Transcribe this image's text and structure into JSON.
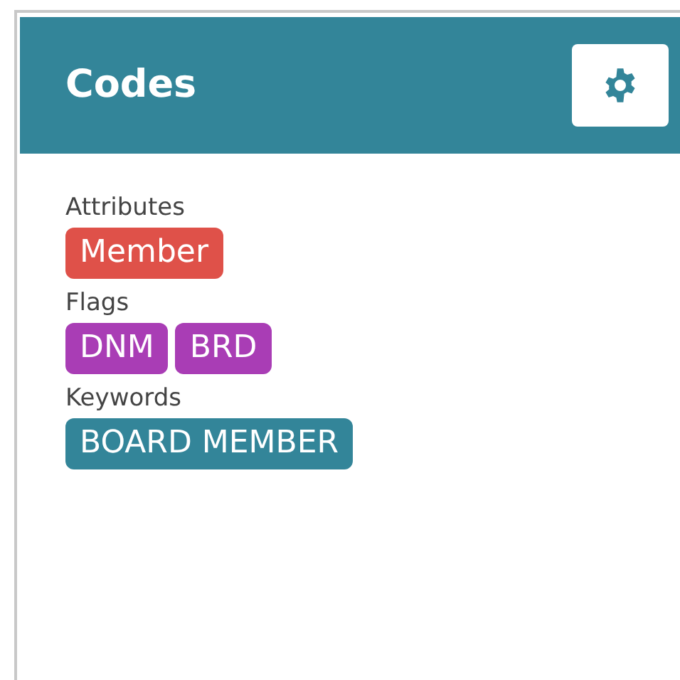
{
  "panel": {
    "title": "Codes"
  },
  "groups": [
    {
      "label": "Attributes",
      "tags": [
        {
          "text": "Member",
          "color": "#df5149"
        }
      ]
    },
    {
      "label": "Flags",
      "tags": [
        {
          "text": "DNM",
          "color": "#a93db5"
        },
        {
          "text": "BRD",
          "color": "#a93db5"
        }
      ]
    },
    {
      "label": "Keywords",
      "tags": [
        {
          "text": "BOARD MEMBER",
          "color": "#338599"
        }
      ]
    }
  ]
}
